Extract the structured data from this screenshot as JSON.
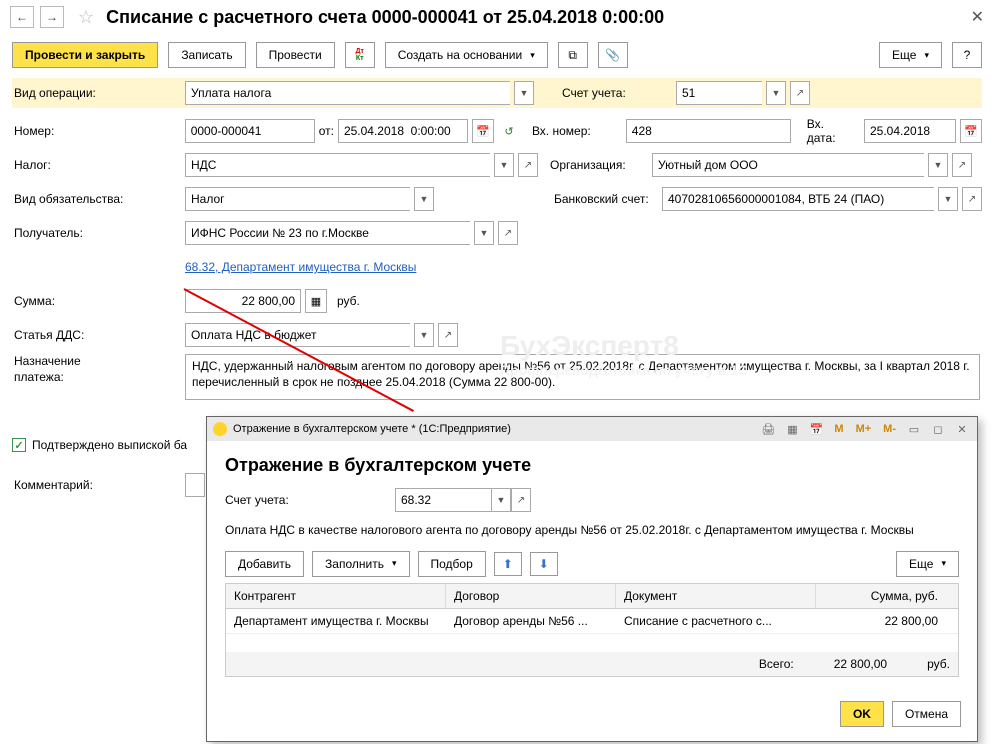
{
  "header": {
    "title": "Списание с расчетного счета 0000-000041 от 25.04.2018 0:00:00"
  },
  "toolbar": {
    "post_close": "Провести и закрыть",
    "write": "Записать",
    "post": "Провести",
    "create_based": "Создать на основании",
    "more": "Еще",
    "help": "?"
  },
  "labels": {
    "op_type": "Вид операции:",
    "account": "Счет учета:",
    "number": "Номер:",
    "date_from": "от:",
    "in_number": "Вх. номер:",
    "in_date": "Вх. дата:",
    "tax": "Налог:",
    "org": "Организация:",
    "liability": "Вид обязательства:",
    "bank_acc": "Банковский счет:",
    "payee": "Получатель:",
    "sum": "Сумма:",
    "rub": "руб.",
    "dds": "Статья ДДС:",
    "purpose1": "Назначение",
    "purpose2": "платежа:",
    "confirmed": "Подтверждено выпиской ба",
    "comment": "Комментарий:"
  },
  "values": {
    "op_type": "Уплата налога",
    "account": "51",
    "number": "0000-000041",
    "date": "25.04.2018  0:00:00",
    "in_number": "428",
    "in_date": "25.04.2018",
    "tax": "НДС",
    "org": "Уютный дом ООО",
    "liability": "Налог",
    "bank_acc": "40702810656000001084, ВТБ 24 (ПАО)",
    "payee": "ИФНС России № 23 по г.Москве",
    "link": "68.32, Департамент имущества г. Москвы",
    "sum": "22 800,00",
    "dds": "Оплата НДС в бюджет",
    "purpose": "НДС, удержанный налоговым агентом по договору аренды №56 от 25.02.2018г. с Департаментом имущества г. Москвы, за I квартал 2018 г. перечисленный в срок не позднее 25.04.2018 (Сумма 22 800-00)."
  },
  "popup": {
    "window_title": "Отражение в бухгалтерском учете * (1С:Предприятие)",
    "title": "Отражение в бухгалтерском учете",
    "account_label": "Счет учета:",
    "account": "68.32",
    "desc": "Оплата НДС в качестве налогового агента по договору аренды №56 от 25.02.2018г. с Департаментом имущества г. Москвы",
    "add": "Добавить",
    "fill": "Заполнить",
    "pick": "Подбор",
    "more": "Еще",
    "cols": {
      "c1": "Контрагент",
      "c2": "Договор",
      "c3": "Документ",
      "c4": "Сумма, руб."
    },
    "row": {
      "c1": "Департамент имущества г. Москвы",
      "c2": "Договор аренды №56 ...",
      "c3": "Списание с расчетного с...",
      "c4": "22 800,00"
    },
    "total_label": "Всего:",
    "total": "22 800,00",
    "total_rub": "руб.",
    "ok": "OK",
    "cancel": "Отмена"
  }
}
